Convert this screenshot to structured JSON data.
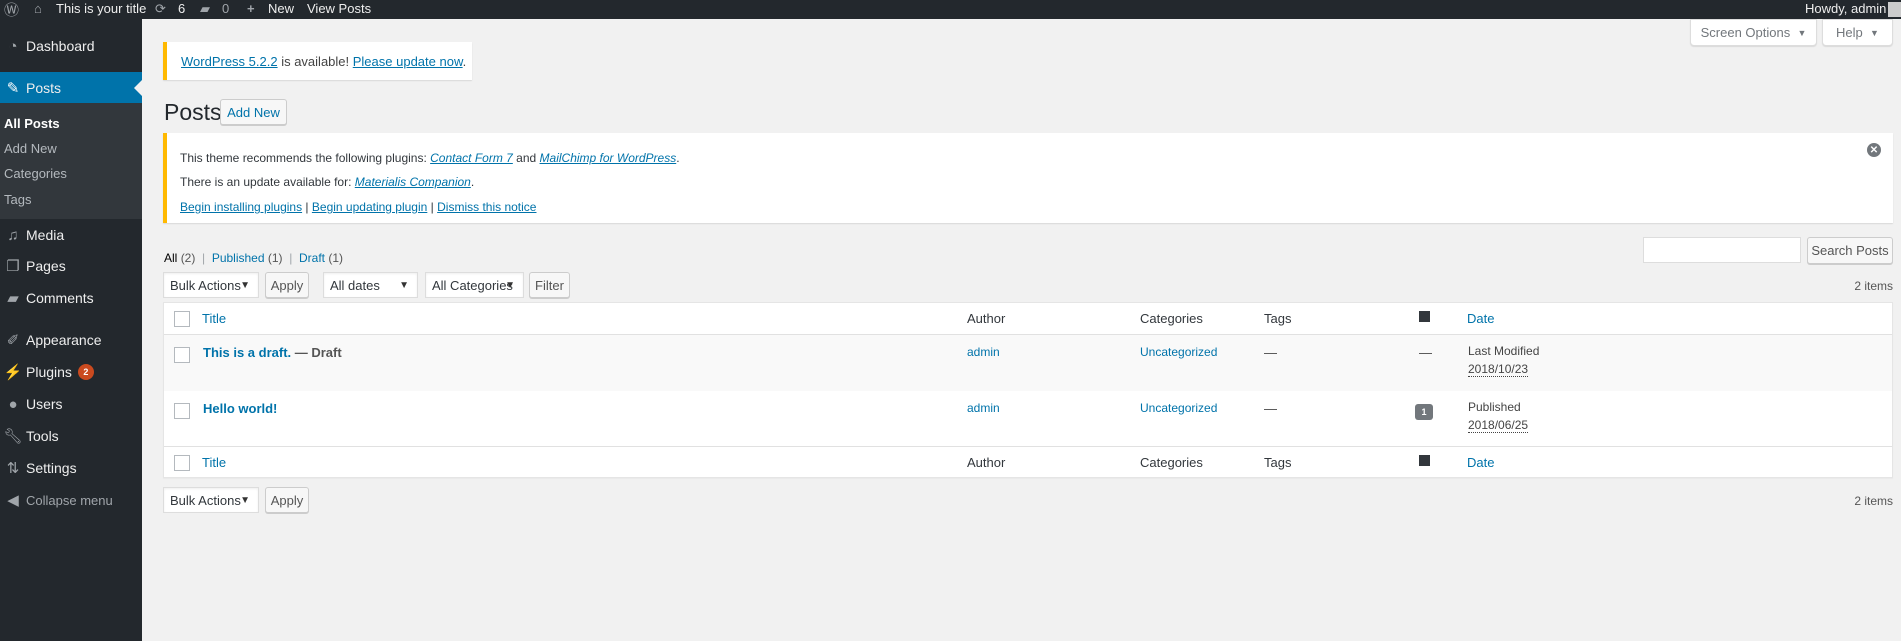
{
  "topbar": {
    "site_title": "This is your title",
    "updates": "6",
    "comments": "0",
    "new": "New",
    "view_posts": "View Posts",
    "howdy": "Howdy, admin"
  },
  "sidebar": {
    "items": [
      {
        "label": "Dashboard",
        "icon": "dashboard-icon"
      },
      {
        "label": "Posts",
        "icon": "pin-icon",
        "active": true
      },
      {
        "label": "Media",
        "icon": "media-icon"
      },
      {
        "label": "Pages",
        "icon": "pages-icon"
      },
      {
        "label": "Comments",
        "icon": "comment-icon"
      },
      {
        "label": "Appearance",
        "icon": "paintbrush-icon"
      },
      {
        "label": "Plugins",
        "icon": "plugin-icon",
        "badge": "2"
      },
      {
        "label": "Users",
        "icon": "user-icon"
      },
      {
        "label": "Tools",
        "icon": "wrench-icon"
      },
      {
        "label": "Settings",
        "icon": "settings-icon"
      },
      {
        "label": "Collapse menu",
        "icon": "collapse-icon"
      }
    ],
    "submenu": [
      "All Posts",
      "Add New",
      "Categories",
      "Tags"
    ]
  },
  "screen_options": "Screen Options",
  "help": "Help",
  "update_notice": {
    "link1": "WordPress 5.2.2",
    "text": " is available! ",
    "link2": "Please update now",
    "end": "."
  },
  "page_title": "Posts",
  "add_new": "Add New",
  "plugin_notice": {
    "line1_text": "This theme recommends the following plugins: ",
    "line1_link1": "Contact Form 7",
    "line1_and": " and ",
    "line1_link2": "MailChimp for WordPress",
    "line2_text": "There is an update available for: ",
    "line2_link": "Materialis Companion",
    "action1": "Begin installing plugins",
    "action2": "Begin updating plugin",
    "action3": "Dismiss this notice"
  },
  "filters": {
    "all": "All",
    "all_count": "(2)",
    "published": "Published",
    "published_count": "(1)",
    "draft": "Draft",
    "draft_count": "(1)"
  },
  "search": {
    "value": "",
    "button": "Search Posts"
  },
  "tablenav": {
    "bulk": "Bulk Actions",
    "apply": "Apply",
    "dates": "All dates",
    "categories": "All Categories",
    "filter": "Filter",
    "items": "2 items"
  },
  "table": {
    "columns": {
      "title": "Title",
      "author": "Author",
      "categories": "Categories",
      "tags": "Tags",
      "date": "Date"
    },
    "rows": [
      {
        "title": "This is a draft.",
        "state": " — Draft",
        "author": "admin",
        "categories": "Uncategorized",
        "tags": "—",
        "comments": "—",
        "date_label": "Last Modified",
        "date": "2018/10/23"
      },
      {
        "title": "Hello world!",
        "state": "",
        "author": "admin",
        "categories": "Uncategorized",
        "tags": "—",
        "comments": "1",
        "date_label": "Published",
        "date": "2018/06/25"
      }
    ]
  },
  "colors": {
    "accent": "#0073aa",
    "sidebar": "#23282d",
    "notice": "#ffb900",
    "badge": "#ca4a1f"
  }
}
